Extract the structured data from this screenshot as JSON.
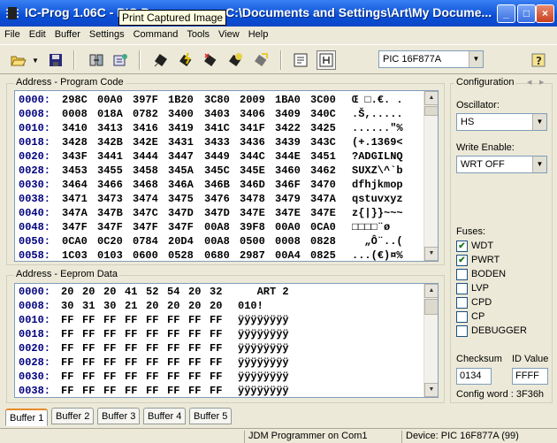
{
  "window": {
    "title": "IC-Prog 1.06C - PIC Programmer - C:\\Documents and Settings\\Art\\My Docume...",
    "tooltip": "Print Captured Image",
    "min_label": "_",
    "max_label": "□",
    "close_label": "×"
  },
  "menu": [
    "File",
    "Edit",
    "Buffer",
    "Settings",
    "Command",
    "Tools",
    "View",
    "Help"
  ],
  "toolbar": {
    "device": "PIC 16F877A",
    "icons": [
      "open-icon",
      "dropdown-arrow-icon",
      "save-icon",
      "swap-bytes-icon",
      "settings-icon",
      "read-chip-icon",
      "program-chip-icon",
      "erase-chip-icon",
      "verify-chip-icon",
      "blank-check-icon",
      "assembler-view-icon",
      "hex-view-icon",
      "help-icon"
    ]
  },
  "program_code": {
    "label": "Address - Program Code",
    "rows": [
      {
        "addr": "0000:",
        "words": [
          "298C",
          "00A0",
          "397F",
          "1B20",
          "3C80",
          "2009",
          "1BA0",
          "3C00"
        ],
        "ascii": "Œ □.€. ."
      },
      {
        "addr": "0008:",
        "words": [
          "0008",
          "018A",
          "0782",
          "3400",
          "3403",
          "3406",
          "3409",
          "340C"
        ],
        "ascii": ".Š,....."
      },
      {
        "addr": "0010:",
        "words": [
          "3410",
          "3413",
          "3416",
          "3419",
          "341C",
          "341F",
          "3422",
          "3425"
        ],
        "ascii": "......\"%"
      },
      {
        "addr": "0018:",
        "words": [
          "3428",
          "342B",
          "342E",
          "3431",
          "3433",
          "3436",
          "3439",
          "343C"
        ],
        "ascii": "(+.1369<"
      },
      {
        "addr": "0020:",
        "words": [
          "343F",
          "3441",
          "3444",
          "3447",
          "3449",
          "344C",
          "344E",
          "3451"
        ],
        "ascii": "?ADGILNQ"
      },
      {
        "addr": "0028:",
        "words": [
          "3453",
          "3455",
          "3458",
          "345A",
          "345C",
          "345E",
          "3460",
          "3462"
        ],
        "ascii": "SUXZ\\^`b"
      },
      {
        "addr": "0030:",
        "words": [
          "3464",
          "3466",
          "3468",
          "346A",
          "346B",
          "346D",
          "346F",
          "3470"
        ],
        "ascii": "dfhjkmop"
      },
      {
        "addr": "0038:",
        "words": [
          "3471",
          "3473",
          "3474",
          "3475",
          "3476",
          "3478",
          "3479",
          "347A"
        ],
        "ascii": "qstuvxyz"
      },
      {
        "addr": "0040:",
        "words": [
          "347A",
          "347B",
          "347C",
          "347D",
          "347D",
          "347E",
          "347E",
          "347E"
        ],
        "ascii": "z{|}}~~~"
      },
      {
        "addr": "0048:",
        "words": [
          "347F",
          "347F",
          "347F",
          "347F",
          "00A8",
          "39F8",
          "00A0",
          "0CA0"
        ],
        "ascii": "□□□□¨ø  "
      },
      {
        "addr": "0050:",
        "words": [
          "0CA0",
          "0C20",
          "0784",
          "20D4",
          "00A8",
          "0500",
          "0008",
          "0828"
        ],
        "ascii": "  „Ô¨..("
      },
      {
        "addr": "0058:",
        "words": [
          "1C03",
          "0103",
          "0600",
          "0528",
          "0680",
          "2987",
          "00A4",
          "0825"
        ],
        "ascii": "...(€)¤%"
      }
    ]
  },
  "eeprom": {
    "label": "Address - Eeprom Data",
    "rows": [
      {
        "addr": "0000:",
        "bytes": [
          "20",
          "20",
          "20",
          "41",
          "52",
          "54",
          "20",
          "32"
        ],
        "ascii": "   ART 2"
      },
      {
        "addr": "0008:",
        "bytes": [
          "30",
          "31",
          "30",
          "21",
          "20",
          "20",
          "20",
          "20"
        ],
        "ascii": "010!    "
      },
      {
        "addr": "0010:",
        "bytes": [
          "FF",
          "FF",
          "FF",
          "FF",
          "FF",
          "FF",
          "FF",
          "FF"
        ],
        "ascii": "ÿÿÿÿÿÿÿÿ"
      },
      {
        "addr": "0018:",
        "bytes": [
          "FF",
          "FF",
          "FF",
          "FF",
          "FF",
          "FF",
          "FF",
          "FF"
        ],
        "ascii": "ÿÿÿÿÿÿÿÿ"
      },
      {
        "addr": "0020:",
        "bytes": [
          "FF",
          "FF",
          "FF",
          "FF",
          "FF",
          "FF",
          "FF",
          "FF"
        ],
        "ascii": "ÿÿÿÿÿÿÿÿ"
      },
      {
        "addr": "0028:",
        "bytes": [
          "FF",
          "FF",
          "FF",
          "FF",
          "FF",
          "FF",
          "FF",
          "FF"
        ],
        "ascii": "ÿÿÿÿÿÿÿÿ"
      },
      {
        "addr": "0030:",
        "bytes": [
          "FF",
          "FF",
          "FF",
          "FF",
          "FF",
          "FF",
          "FF",
          "FF"
        ],
        "ascii": "ÿÿÿÿÿÿÿÿ"
      },
      {
        "addr": "0038:",
        "bytes": [
          "FF",
          "FF",
          "FF",
          "FF",
          "FF",
          "FF",
          "FF",
          "FF"
        ],
        "ascii": "ÿÿÿÿÿÿÿÿ"
      }
    ]
  },
  "config": {
    "label": "Configuration",
    "oscillator_label": "Oscillator:",
    "oscillator": "HS",
    "write_enable_label": "Write Enable:",
    "write_enable": "WRT OFF",
    "fuses_label": "Fuses:",
    "fuses": [
      {
        "name": "WDT",
        "checked": true
      },
      {
        "name": "PWRT",
        "checked": true
      },
      {
        "name": "BODEN",
        "checked": false
      },
      {
        "name": "LVP",
        "checked": false
      },
      {
        "name": "CPD",
        "checked": false
      },
      {
        "name": "CP",
        "checked": false
      },
      {
        "name": "DEBUGGER",
        "checked": false
      }
    ],
    "checksum_label": "Checksum",
    "checksum": "0134",
    "id_label": "ID Value",
    "id_value": "FFFF",
    "config_word": "Config word : 3F36h"
  },
  "tabs": [
    "Buffer 1",
    "Buffer 2",
    "Buffer 3",
    "Buffer 4",
    "Buffer 5"
  ],
  "status": {
    "programmer": "JDM Programmer on Com1",
    "device": "Device: PIC 16F877A  (99)"
  }
}
